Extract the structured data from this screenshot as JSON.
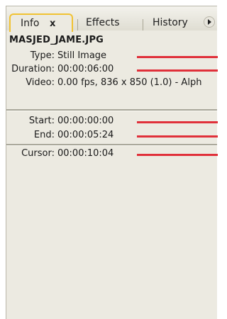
{
  "tabs": {
    "info": "Info",
    "info_close": "x",
    "effects": "Effects",
    "history": "History"
  },
  "info": {
    "filename": "MASJED_JAME.JPG",
    "type_label": "Type:",
    "type_value": "Still Image",
    "duration_label": "Duration:",
    "duration_value": "00:00:06:00",
    "video_label": "Video:",
    "video_value": "0.00 fps, 836 x 850 (1.0) - Alph",
    "start_label": "Start:",
    "start_value": "00:00:00:00",
    "end_label": "End:",
    "end_value": "00:00:05:24",
    "cursor_label": "Cursor:",
    "cursor_value": "00:00:10:04"
  },
  "colors": {
    "annotation_line": "#e0303a",
    "active_tab_border": "#f1c232",
    "panel_bg": "#eceae1"
  }
}
